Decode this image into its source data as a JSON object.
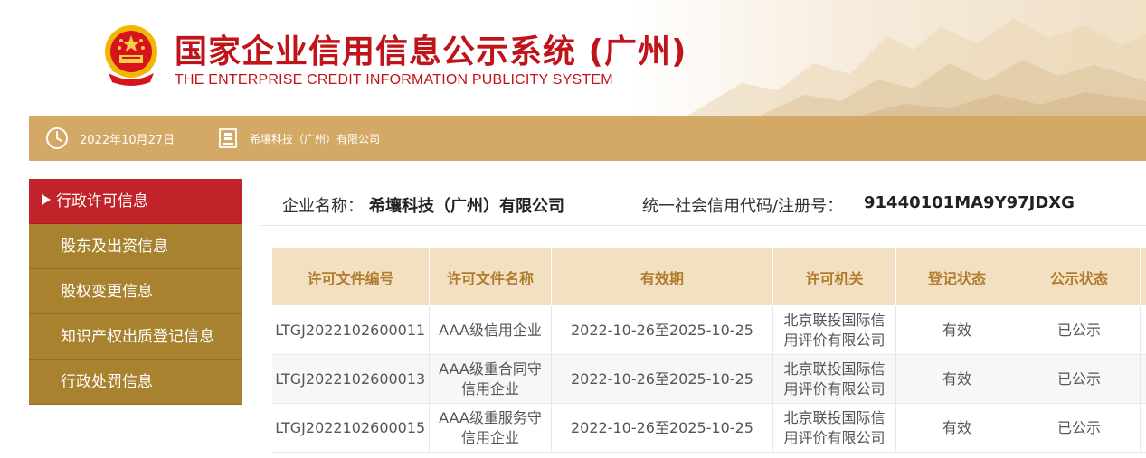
{
  "header": {
    "title": "国家企业信用信息公示系统 (广州)",
    "subtitle": "THE ENTERPRISE CREDIT INFORMATION PUBLICITY SYSTEM",
    "emblem": "national-emblem"
  },
  "infobar": {
    "date": "2022年10月27日",
    "company": "希壤科技（广州）有限公司",
    "date_icon": "clock-icon",
    "company_icon": "building-icon"
  },
  "sidebar": {
    "items": [
      {
        "label": "行政许可信息",
        "active": true
      },
      {
        "label": "股东及出资信息",
        "active": false
      },
      {
        "label": "股权变更信息",
        "active": false
      },
      {
        "label": "知识产权出质登记信息",
        "active": false
      },
      {
        "label": "行政处罚信息",
        "active": false
      }
    ]
  },
  "main": {
    "company_label": "企业名称：",
    "company_name": "希壤科技（广州）有限公司",
    "code_label": "统一社会信用代码/注册号：",
    "code_value": "91440101MA9Y97JDXG"
  },
  "table": {
    "headers": [
      "许可文件编号",
      "许可文件名称",
      "有效期",
      "许可机关",
      "登记状态",
      "公示状态"
    ],
    "rows": [
      [
        "LTGJ2022102600011",
        "AAA级信用企业",
        "2022-10-26至2025-10-25",
        "北京联投国际信用评价有限公司",
        "有效",
        "已公示"
      ],
      [
        "LTGJ2022102600013",
        "AAA级重合同守信用企业",
        "2022-10-26至2025-10-25",
        "北京联投国际信用评价有限公司",
        "有效",
        "已公示"
      ],
      [
        "LTGJ2022102600015",
        "AAA级重服务守信用企业",
        "2022-10-26至2025-10-25",
        "北京联投国际信用评价有限公司",
        "有效",
        "已公示"
      ]
    ]
  },
  "colors": {
    "brand_red": "#c0141b",
    "gold": "#d4a966",
    "sidebar_gold": "#a8822e",
    "active_red": "#c1232a",
    "table_header_bg": "#f3dfc2",
    "table_header_text": "#b07d2e"
  }
}
